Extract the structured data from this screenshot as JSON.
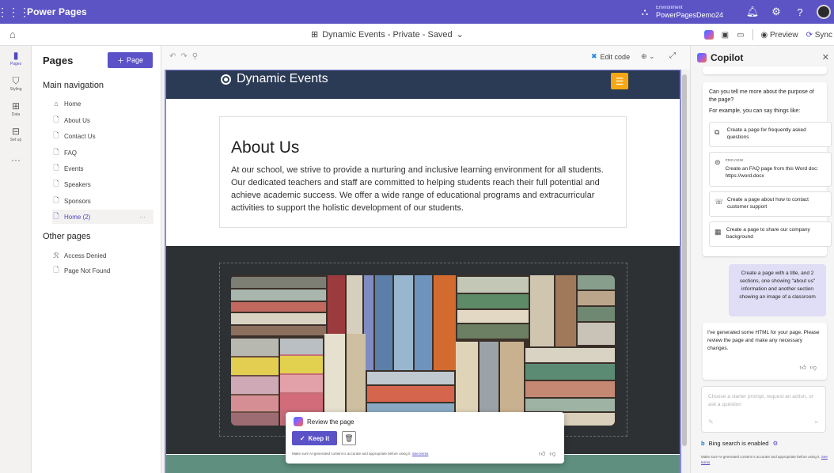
{
  "topbar": {
    "app_name": "Power Pages",
    "environment_label": "Environment",
    "environment_name": "PowerPagesDemo24"
  },
  "subbar": {
    "site_status": "Dynamic Events - Private - Saved",
    "preview_label": "Preview",
    "sync_label": "Sync"
  },
  "rail": {
    "items": [
      {
        "label": "Pages",
        "icon": "page-icon"
      },
      {
        "label": "Styling",
        "icon": "brush-icon"
      },
      {
        "label": "Data",
        "icon": "table-icon"
      },
      {
        "label": "Set up",
        "icon": "setup-icon"
      }
    ],
    "more": "···"
  },
  "pages_panel": {
    "title": "Pages",
    "add_button": "Page",
    "main_nav_title": "Main navigation",
    "main_items": [
      "Home",
      "About Us",
      "Contact Us",
      "FAQ",
      "Events",
      "Speakers",
      "Sponsors",
      "Home (2)"
    ],
    "other_title": "Other pages",
    "other_items": [
      "Access Denied",
      "Page Not Found"
    ]
  },
  "canvas_toolbar": {
    "edit_code": "Edit code"
  },
  "site": {
    "brand": "Dynamic Events",
    "about_title": "About Us",
    "about_text": "At our school, we strive to provide a nurturing and inclusive learning environment for all students. Our dedicated teachers and staff are committed to helping students reach their full potential and achieve academic success. We offer a wide range of educational programs and extracurricular activities to support the holistic development of our students."
  },
  "review": {
    "title": "Review the page",
    "keep_label": "Keep it",
    "disclaimer": "Make sure AI-generated content is accurate and appropriate before using it.",
    "terms_link": "See terms"
  },
  "copilot": {
    "title": "Copilot",
    "intro": "Can you tell me more about the purpose of the page?",
    "examples_intro": "For example, you can say things like:",
    "suggestions": [
      {
        "text": "Create a page for frequently asked questions",
        "icon": "page-add-icon",
        "badge": ""
      },
      {
        "text": "Create an FAQ page from this Word doc: https://word.docx",
        "icon": "document-icon",
        "badge": "PREVIEW"
      },
      {
        "text": "Create a page about how to contact customer support",
        "icon": "support-icon",
        "badge": ""
      },
      {
        "text": "Create a page to share our company background",
        "icon": "building-icon",
        "badge": ""
      }
    ],
    "user_message": "Create a page with a title, and 2 sections, one showing \"about us\" information and another section showing an image of a classroom",
    "ai_message": "I've generated some HTML for your page. Please review the page and make any necessary changes.",
    "input_placeholder": "Choose a starter prompt, request an action, or ask a question",
    "bing_label": "Bing search is enabled",
    "bottom_disclaimer": "Make sure AI-generated content is accurate and appropriate before using it.",
    "bottom_terms": "See terms"
  },
  "colors": {
    "brand_purple": "#5c54c4",
    "button_purple": "#5b52c8",
    "site_header": "#2c3b55",
    "hamburger": "#f6a814",
    "dark_section": "#2e3133"
  }
}
